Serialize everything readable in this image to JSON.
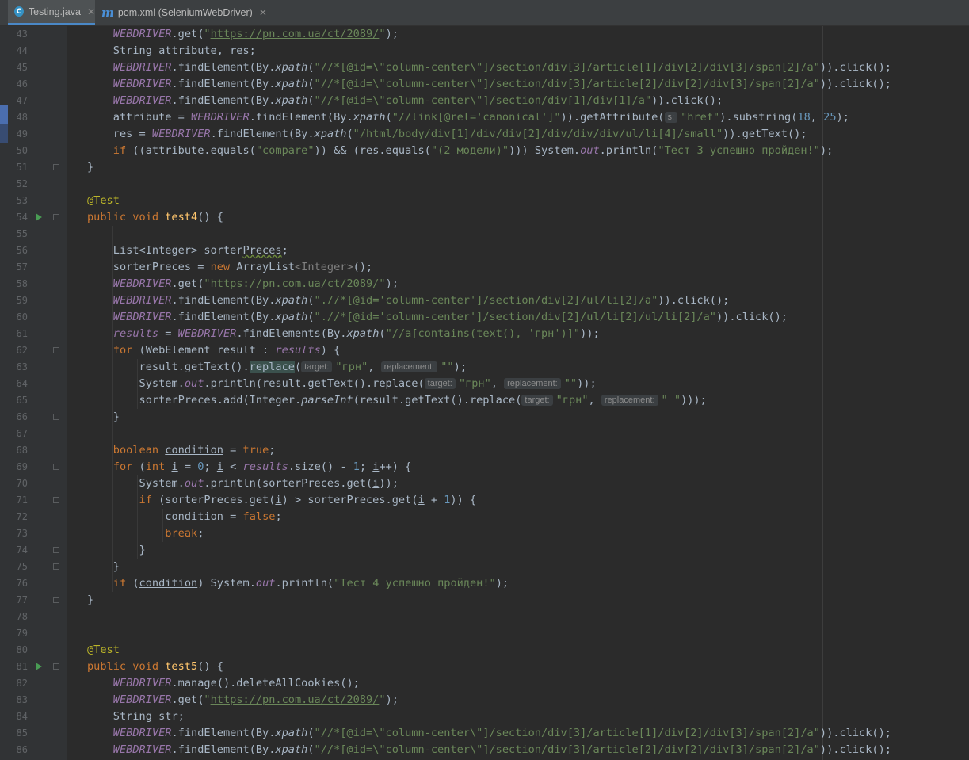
{
  "tabs": [
    {
      "label": "Testing.java",
      "icon": "java-class-icon",
      "active": true
    },
    {
      "label": "pom.xml (SeleniumWebDriver)",
      "icon": "maven-icon",
      "active": false
    }
  ],
  "colors": {
    "keyword": "#cc7832",
    "string": "#6a8759",
    "number": "#6897bb",
    "annotation": "#bbb529",
    "field": "#9876aa",
    "text": "#a9b7c6"
  },
  "line_numbers": [
    "43",
    "44",
    "45",
    "46",
    "47",
    "48",
    "49",
    "50",
    "51",
    "52",
    "53",
    "54",
    "55",
    "56",
    "57",
    "58",
    "59",
    "60",
    "61",
    "62",
    "63",
    "64",
    "65",
    "66",
    "67",
    "68",
    "69",
    "70",
    "71",
    "72",
    "73",
    "74",
    "75",
    "76",
    "77",
    "78",
    "79",
    "80",
    "81",
    "82",
    "83",
    "84",
    "85",
    "86"
  ],
  "code_lines": [
    [
      {
        "c": "fld",
        "t": "WEBDRIVER"
      },
      {
        "c": "",
        "t": ".get("
      },
      {
        "c": "str",
        "t": "\""
      },
      {
        "c": "url",
        "t": "https://pn.com.ua/ct/2089/"
      },
      {
        "c": "str",
        "t": "\""
      },
      {
        "c": "",
        "t": ");"
      }
    ],
    [
      {
        "c": "",
        "t": "String attribute, res;"
      }
    ],
    [
      {
        "c": "fld",
        "t": "WEBDRIVER"
      },
      {
        "c": "",
        "t": ".findElement(By."
      },
      {
        "c": "st",
        "t": "xpath"
      },
      {
        "c": "",
        "t": "("
      },
      {
        "c": "str",
        "t": "\"//*[@id=\\\"column-center\\\"]/section/div[3]/article[1]/div[2]/div[3]/span[2]/a\""
      },
      {
        "c": "",
        "t": ")).click();"
      }
    ],
    [
      {
        "c": "fld",
        "t": "WEBDRIVER"
      },
      {
        "c": "",
        "t": ".findElement(By."
      },
      {
        "c": "st",
        "t": "xpath"
      },
      {
        "c": "",
        "t": "("
      },
      {
        "c": "str",
        "t": "\"//*[@id=\\\"column-center\\\"]/section/div[3]/article[2]/div[2]/div[3]/span[2]/a\""
      },
      {
        "c": "",
        "t": ")).click();"
      }
    ],
    [
      {
        "c": "fld",
        "t": "WEBDRIVER"
      },
      {
        "c": "",
        "t": ".findElement(By."
      },
      {
        "c": "st",
        "t": "xpath"
      },
      {
        "c": "",
        "t": "("
      },
      {
        "c": "str",
        "t": "\"//*[@id=\\\"column-center\\\"]/section/div[1]/div[1]/a\""
      },
      {
        "c": "",
        "t": ")).click();"
      }
    ],
    [
      {
        "c": "",
        "t": "attribute = "
      },
      {
        "c": "fld",
        "t": "WEBDRIVER"
      },
      {
        "c": "",
        "t": ".findElement(By."
      },
      {
        "c": "st",
        "t": "xpath"
      },
      {
        "c": "",
        "t": "("
      },
      {
        "c": "str",
        "t": "\"//link[@rel='canonical']\""
      },
      {
        "c": "",
        "t": ")).getAttribute("
      },
      {
        "c": "hint",
        "t": "s:"
      },
      {
        "c": "str",
        "t": "\"href\""
      },
      {
        "c": "",
        "t": ").substring("
      },
      {
        "c": "num",
        "t": "18"
      },
      {
        "c": "",
        "t": ", "
      },
      {
        "c": "num",
        "t": "25"
      },
      {
        "c": "",
        "t": ");"
      }
    ],
    [
      {
        "c": "",
        "t": "res = "
      },
      {
        "c": "fld",
        "t": "WEBDRIVER"
      },
      {
        "c": "",
        "t": ".findElement(By."
      },
      {
        "c": "st",
        "t": "xpath"
      },
      {
        "c": "",
        "t": "("
      },
      {
        "c": "str",
        "t": "\"/html/body/div[1]/div/div[2]/div/div/div/ul/li[4]/small\""
      },
      {
        "c": "",
        "t": ")).getText();"
      }
    ],
    [
      {
        "c": "kw",
        "t": "if"
      },
      {
        "c": "",
        "t": " ((attribute.equals("
      },
      {
        "c": "str",
        "t": "\"compare\""
      },
      {
        "c": "",
        "t": ")) && (res.equals("
      },
      {
        "c": "str",
        "t": "\"(2 модели)\""
      },
      {
        "c": "",
        "t": "))) System."
      },
      {
        "c": "fld",
        "t": "out"
      },
      {
        "c": "",
        "t": ".println("
      },
      {
        "c": "str",
        "t": "\"Тест 3 успешно пройден!\""
      },
      {
        "c": "",
        "t": ");"
      }
    ],
    [
      {
        "c": "",
        "t": "}"
      }
    ],
    [],
    [
      {
        "c": "ann",
        "t": "@Test"
      }
    ],
    [
      {
        "c": "kw",
        "t": "public void "
      },
      {
        "c": "fn",
        "t": "test4"
      },
      {
        "c": "",
        "t": "() {"
      }
    ],
    [],
    [
      {
        "c": "",
        "t": "List<Integer> sorter"
      },
      {
        "c": "wavy",
        "t": "Preces"
      },
      {
        "c": "",
        "t": ";"
      }
    ],
    [
      {
        "c": "",
        "t": "sorterPreces = "
      },
      {
        "c": "kw",
        "t": "new "
      },
      {
        "c": "",
        "t": "ArrayList"
      },
      {
        "c": "gen",
        "t": "<Integer>"
      },
      {
        "c": "",
        "t": "();"
      }
    ],
    [
      {
        "c": "fld",
        "t": "WEBDRIVER"
      },
      {
        "c": "",
        "t": ".get("
      },
      {
        "c": "str",
        "t": "\""
      },
      {
        "c": "url",
        "t": "https://pn.com.ua/ct/2089/"
      },
      {
        "c": "str",
        "t": "\""
      },
      {
        "c": "",
        "t": ");"
      }
    ],
    [
      {
        "c": "fld",
        "t": "WEBDRIVER"
      },
      {
        "c": "",
        "t": ".findElement(By."
      },
      {
        "c": "st",
        "t": "xpath"
      },
      {
        "c": "",
        "t": "("
      },
      {
        "c": "str",
        "t": "\".//*[@id='column-center']/section/div[2]/ul/li[2]/a\""
      },
      {
        "c": "",
        "t": ")).click();"
      }
    ],
    [
      {
        "c": "fld",
        "t": "WEBDRIVER"
      },
      {
        "c": "",
        "t": ".findElement(By."
      },
      {
        "c": "st",
        "t": "xpath"
      },
      {
        "c": "",
        "t": "("
      },
      {
        "c": "str",
        "t": "\".//*[@id='column-center']/section/div[2]/ul/li[2]/ul/li[2]/a\""
      },
      {
        "c": "",
        "t": ")).click();"
      }
    ],
    [
      {
        "c": "fld",
        "t": "results"
      },
      {
        "c": "",
        "t": " = "
      },
      {
        "c": "fld",
        "t": "WEBDRIVER"
      },
      {
        "c": "",
        "t": ".findElements(By."
      },
      {
        "c": "st",
        "t": "xpath"
      },
      {
        "c": "",
        "t": "("
      },
      {
        "c": "str",
        "t": "\"//a[contains(text(), 'грн')]\""
      },
      {
        "c": "",
        "t": "));"
      }
    ],
    [
      {
        "c": "kw",
        "t": "for"
      },
      {
        "c": "",
        "t": " (WebElement result : "
      },
      {
        "c": "fld",
        "t": "results"
      },
      {
        "c": "",
        "t": ") {"
      }
    ],
    [
      {
        "c": "",
        "t": "    result.getText()."
      },
      {
        "c": "hl",
        "t": "replace"
      },
      {
        "c": "",
        "t": "("
      },
      {
        "c": "hint",
        "t": "target:"
      },
      {
        "c": "str",
        "t": "\"грн\""
      },
      {
        "c": "",
        "t": ", "
      },
      {
        "c": "hint",
        "t": "replacement:"
      },
      {
        "c": "str",
        "t": "\"\""
      },
      {
        "c": "",
        "t": ");"
      }
    ],
    [
      {
        "c": "",
        "t": "    System."
      },
      {
        "c": "fld",
        "t": "out"
      },
      {
        "c": "",
        "t": ".println(result.getText().replace("
      },
      {
        "c": "hint",
        "t": "target:"
      },
      {
        "c": "str",
        "t": "\"грн\""
      },
      {
        "c": "",
        "t": ", "
      },
      {
        "c": "hint",
        "t": "replacement:"
      },
      {
        "c": "str",
        "t": "\"\""
      },
      {
        "c": "",
        "t": "));"
      }
    ],
    [
      {
        "c": "",
        "t": "    sorterPreces.add(Integer."
      },
      {
        "c": "st",
        "t": "parseInt"
      },
      {
        "c": "",
        "t": "(result.getText().replace("
      },
      {
        "c": "hint",
        "t": "target:"
      },
      {
        "c": "str",
        "t": "\"грн\""
      },
      {
        "c": "",
        "t": ", "
      },
      {
        "c": "hint",
        "t": "replacement:"
      },
      {
        "c": "str",
        "t": "\" \""
      },
      {
        "c": "",
        "t": ")));"
      }
    ],
    [
      {
        "c": "",
        "t": "}"
      }
    ],
    [],
    [
      {
        "c": "kw",
        "t": "boolean "
      },
      {
        "c": "und",
        "t": "condition"
      },
      {
        "c": "",
        "t": " = "
      },
      {
        "c": "kw",
        "t": "true"
      },
      {
        "c": "",
        "t": ";"
      }
    ],
    [
      {
        "c": "kw",
        "t": "for"
      },
      {
        "c": "",
        "t": " ("
      },
      {
        "c": "kw",
        "t": "int "
      },
      {
        "c": "und",
        "t": "i"
      },
      {
        "c": "",
        "t": " = "
      },
      {
        "c": "num",
        "t": "0"
      },
      {
        "c": "",
        "t": "; "
      },
      {
        "c": "und",
        "t": "i"
      },
      {
        "c": "",
        "t": " < "
      },
      {
        "c": "fld",
        "t": "results"
      },
      {
        "c": "",
        "t": ".size() - "
      },
      {
        "c": "num",
        "t": "1"
      },
      {
        "c": "",
        "t": "; "
      },
      {
        "c": "und",
        "t": "i"
      },
      {
        "c": "",
        "t": "++) {"
      }
    ],
    [
      {
        "c": "",
        "t": "    System."
      },
      {
        "c": "fld",
        "t": "out"
      },
      {
        "c": "",
        "t": ".println(sorterPreces.get("
      },
      {
        "c": "und",
        "t": "i"
      },
      {
        "c": "",
        "t": "));"
      }
    ],
    [
      {
        "c": "",
        "t": "    "
      },
      {
        "c": "kw",
        "t": "if"
      },
      {
        "c": "",
        "t": " (sorterPreces.get("
      },
      {
        "c": "und",
        "t": "i"
      },
      {
        "c": "",
        "t": ") > sorterPreces.get("
      },
      {
        "c": "und",
        "t": "i"
      },
      {
        "c": "",
        "t": " + "
      },
      {
        "c": "num",
        "t": "1"
      },
      {
        "c": "",
        "t": ")) {"
      }
    ],
    [
      {
        "c": "",
        "t": "        "
      },
      {
        "c": "und",
        "t": "condition"
      },
      {
        "c": "",
        "t": " = "
      },
      {
        "c": "kw",
        "t": "false"
      },
      {
        "c": "",
        "t": ";"
      }
    ],
    [
      {
        "c": "",
        "t": "        "
      },
      {
        "c": "kw",
        "t": "break"
      },
      {
        "c": "",
        "t": ";"
      }
    ],
    [
      {
        "c": "",
        "t": "    }"
      }
    ],
    [
      {
        "c": "",
        "t": "}"
      }
    ],
    [
      {
        "c": "kw",
        "t": "if"
      },
      {
        "c": "",
        "t": " ("
      },
      {
        "c": "und",
        "t": "condition"
      },
      {
        "c": "",
        "t": ") System."
      },
      {
        "c": "fld",
        "t": "out"
      },
      {
        "c": "",
        "t": ".println("
      },
      {
        "c": "str",
        "t": "\"Тест 4 успешно пройден!\""
      },
      {
        "c": "",
        "t": ");"
      }
    ],
    [
      {
        "c": "",
        "t": "}"
      }
    ],
    [],
    [],
    [
      {
        "c": "ann",
        "t": "@Test"
      }
    ],
    [
      {
        "c": "kw",
        "t": "public void "
      },
      {
        "c": "fn",
        "t": "test5"
      },
      {
        "c": "",
        "t": "() {"
      }
    ],
    [
      {
        "c": "fld",
        "t": "WEBDRIVER"
      },
      {
        "c": "",
        "t": ".manage().deleteAllCookies();"
      }
    ],
    [
      {
        "c": "fld",
        "t": "WEBDRIVER"
      },
      {
        "c": "",
        "t": ".get("
      },
      {
        "c": "str",
        "t": "\""
      },
      {
        "c": "url",
        "t": "https://pn.com.ua/ct/2089/"
      },
      {
        "c": "str",
        "t": "\""
      },
      {
        "c": "",
        "t": ");"
      }
    ],
    [
      {
        "c": "",
        "t": "String str;"
      }
    ],
    [
      {
        "c": "fld",
        "t": "WEBDRIVER"
      },
      {
        "c": "",
        "t": ".findElement(By."
      },
      {
        "c": "st",
        "t": "xpath"
      },
      {
        "c": "",
        "t": "("
      },
      {
        "c": "str",
        "t": "\"//*[@id=\\\"column-center\\\"]/section/div[3]/article[1]/div[2]/div[3]/span[2]/a\""
      },
      {
        "c": "",
        "t": ")).click();"
      }
    ],
    [
      {
        "c": "fld",
        "t": "WEBDRIVER"
      },
      {
        "c": "",
        "t": ".findElement(By."
      },
      {
        "c": "st",
        "t": "xpath"
      },
      {
        "c": "",
        "t": "("
      },
      {
        "c": "str",
        "t": "\"//*[@id=\\\"column-center\\\"]/section/div[3]/article[2]/div[2]/div[3]/span[2]/a\""
      },
      {
        "c": "",
        "t": ")).click();"
      }
    ]
  ]
}
